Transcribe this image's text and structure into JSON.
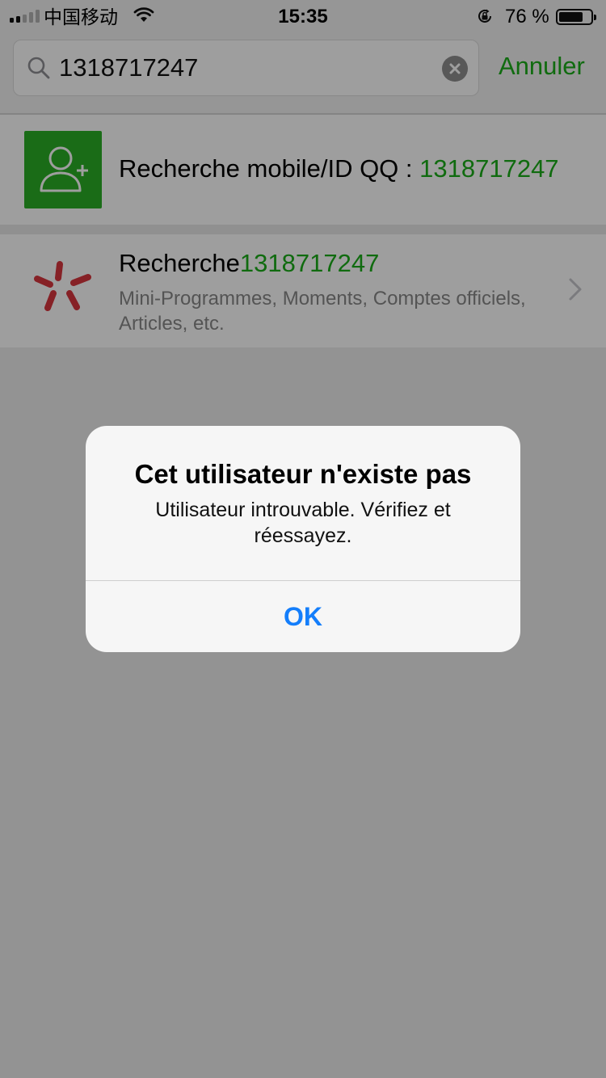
{
  "status_bar": {
    "carrier": "中国移动",
    "time": "15:35",
    "battery_percent_label": "76 %",
    "battery_level": 0.76,
    "signal_bars_active": 2,
    "signal_bars_total": 5,
    "icons": [
      "signal-icon",
      "wifi-icon",
      "orientation-lock-icon",
      "battery-icon"
    ]
  },
  "search": {
    "query": "1318717247",
    "cancel_label": "Annuler",
    "icons": [
      "search-icon",
      "clear-icon"
    ]
  },
  "results": {
    "mobile_search": {
      "label": "Recherche mobile/ID QQ : ",
      "query": "1318717247",
      "icon": "contact-add-icon"
    },
    "web_search": {
      "label": "Recherche",
      "query": "1318717247",
      "subtitle": "Mini-Programmes, Moments, Comptes officiels, Articles, etc.",
      "icon": "search-logo-icon"
    }
  },
  "alert": {
    "title": "Cet utilisateur n'existe pas",
    "message": "Utilisateur introuvable. Vérifiez et réessayez.",
    "ok_label": "OK"
  },
  "colors": {
    "accent_green": "#1aad19",
    "icon_green": "#2aae26",
    "ios_blue": "#147efb",
    "logo_red": "#d9363e"
  }
}
